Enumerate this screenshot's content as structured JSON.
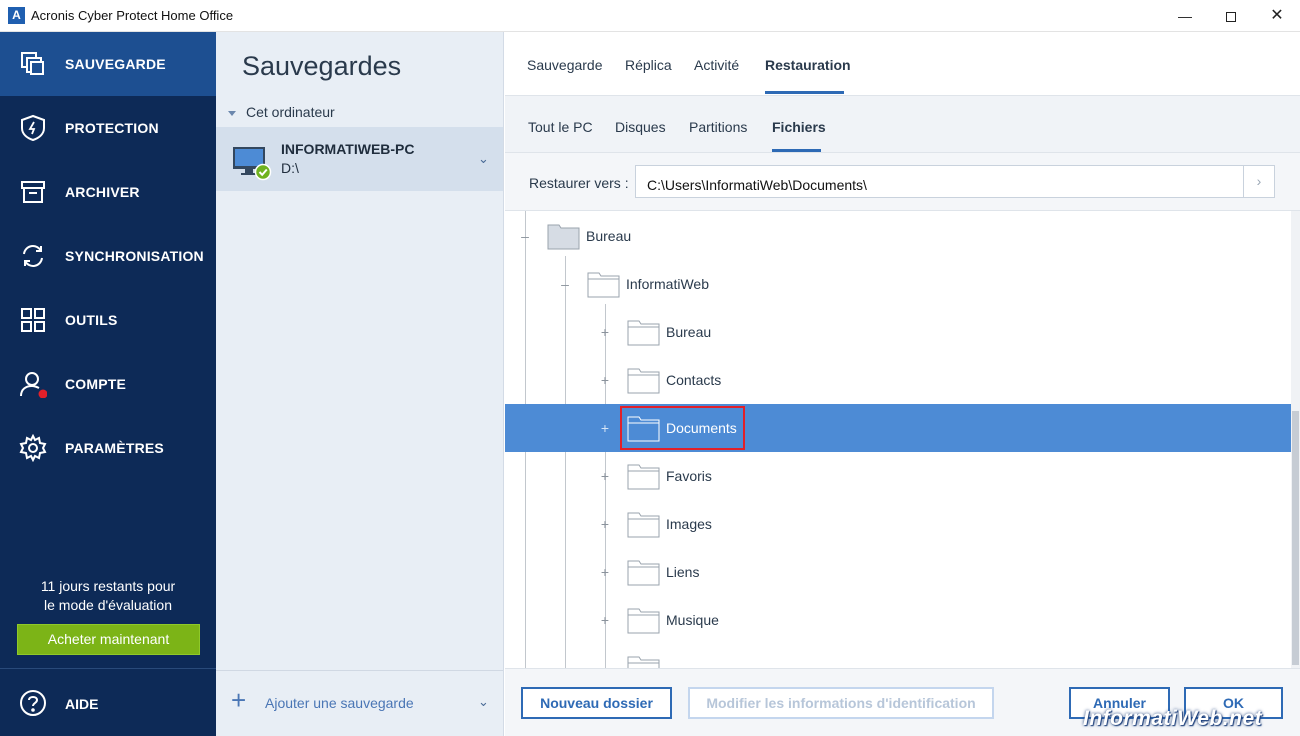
{
  "window": {
    "title": "Acronis Cyber Protect Home Office",
    "logo_letter": "A"
  },
  "sidebar": {
    "items": [
      {
        "label": "SAUVEGARDE",
        "icon": "backup-icon",
        "active": true
      },
      {
        "label": "PROTECTION",
        "icon": "shield-icon",
        "active": false
      },
      {
        "label": "ARCHIVER",
        "icon": "archive-icon",
        "active": false
      },
      {
        "label": "SYNCHRONISATION",
        "icon": "sync-icon",
        "active": false
      },
      {
        "label": "OUTILS",
        "icon": "tools-grid-icon",
        "active": false
      },
      {
        "label": "COMPTE",
        "icon": "account-icon",
        "active": false
      },
      {
        "label": "PARAMÈTRES",
        "icon": "gear-icon",
        "active": false
      }
    ],
    "trial_line1": "11 jours restants pour",
    "trial_line2": "le mode d'évaluation",
    "buy_label": "Acheter maintenant",
    "help_label": "AIDE"
  },
  "backups": {
    "title": "Sauvegardes",
    "group": "Cet ordinateur",
    "item_name": "INFORMATIWEB-PC",
    "item_sub": "D:\\",
    "add_label": "Ajouter une sauvegarde"
  },
  "tabs": {
    "top": [
      {
        "label": "Sauvegarde",
        "active": false
      },
      {
        "label": "Réplica",
        "active": false
      },
      {
        "label": "Activité",
        "active": false
      },
      {
        "label": "Restauration",
        "active": true
      }
    ],
    "sub": [
      {
        "label": "Tout le PC",
        "active": false
      },
      {
        "label": "Disques",
        "active": false
      },
      {
        "label": "Partitions",
        "active": false
      },
      {
        "label": "Fichiers",
        "active": true
      }
    ]
  },
  "restore": {
    "label": "Restaurer vers :",
    "path": "C:\\Users\\InformatiWeb\\Documents\\"
  },
  "tree": {
    "nodes": [
      {
        "label": "Bureau",
        "level": 0,
        "toggle": "–",
        "selected": false
      },
      {
        "label": "InformatiWeb",
        "level": 1,
        "toggle": "–",
        "selected": false
      },
      {
        "label": "Bureau",
        "level": 2,
        "toggle": "+",
        "selected": false
      },
      {
        "label": "Contacts",
        "level": 2,
        "toggle": "+",
        "selected": false
      },
      {
        "label": "Documents",
        "level": 2,
        "toggle": "+",
        "selected": true
      },
      {
        "label": "Favoris",
        "level": 2,
        "toggle": "+",
        "selected": false
      },
      {
        "label": "Images",
        "level": 2,
        "toggle": "+",
        "selected": false
      },
      {
        "label": "Liens",
        "level": 2,
        "toggle": "+",
        "selected": false
      },
      {
        "label": "Musique",
        "level": 2,
        "toggle": "+",
        "selected": false
      }
    ]
  },
  "buttons": {
    "new_folder": "Nouveau dossier",
    "modify": "Modifier les informations d'identification",
    "cancel": "Annuler",
    "ok": "OK"
  },
  "watermark": "InformatiWeb.net",
  "colors": {
    "sidebar_bg": "#0d2a57",
    "sidebar_active": "#1d4f91",
    "accent": "#2e6ab5",
    "selection": "#4d8bd5",
    "buy_button": "#7cb417",
    "highlight_box": "#e1202a"
  }
}
